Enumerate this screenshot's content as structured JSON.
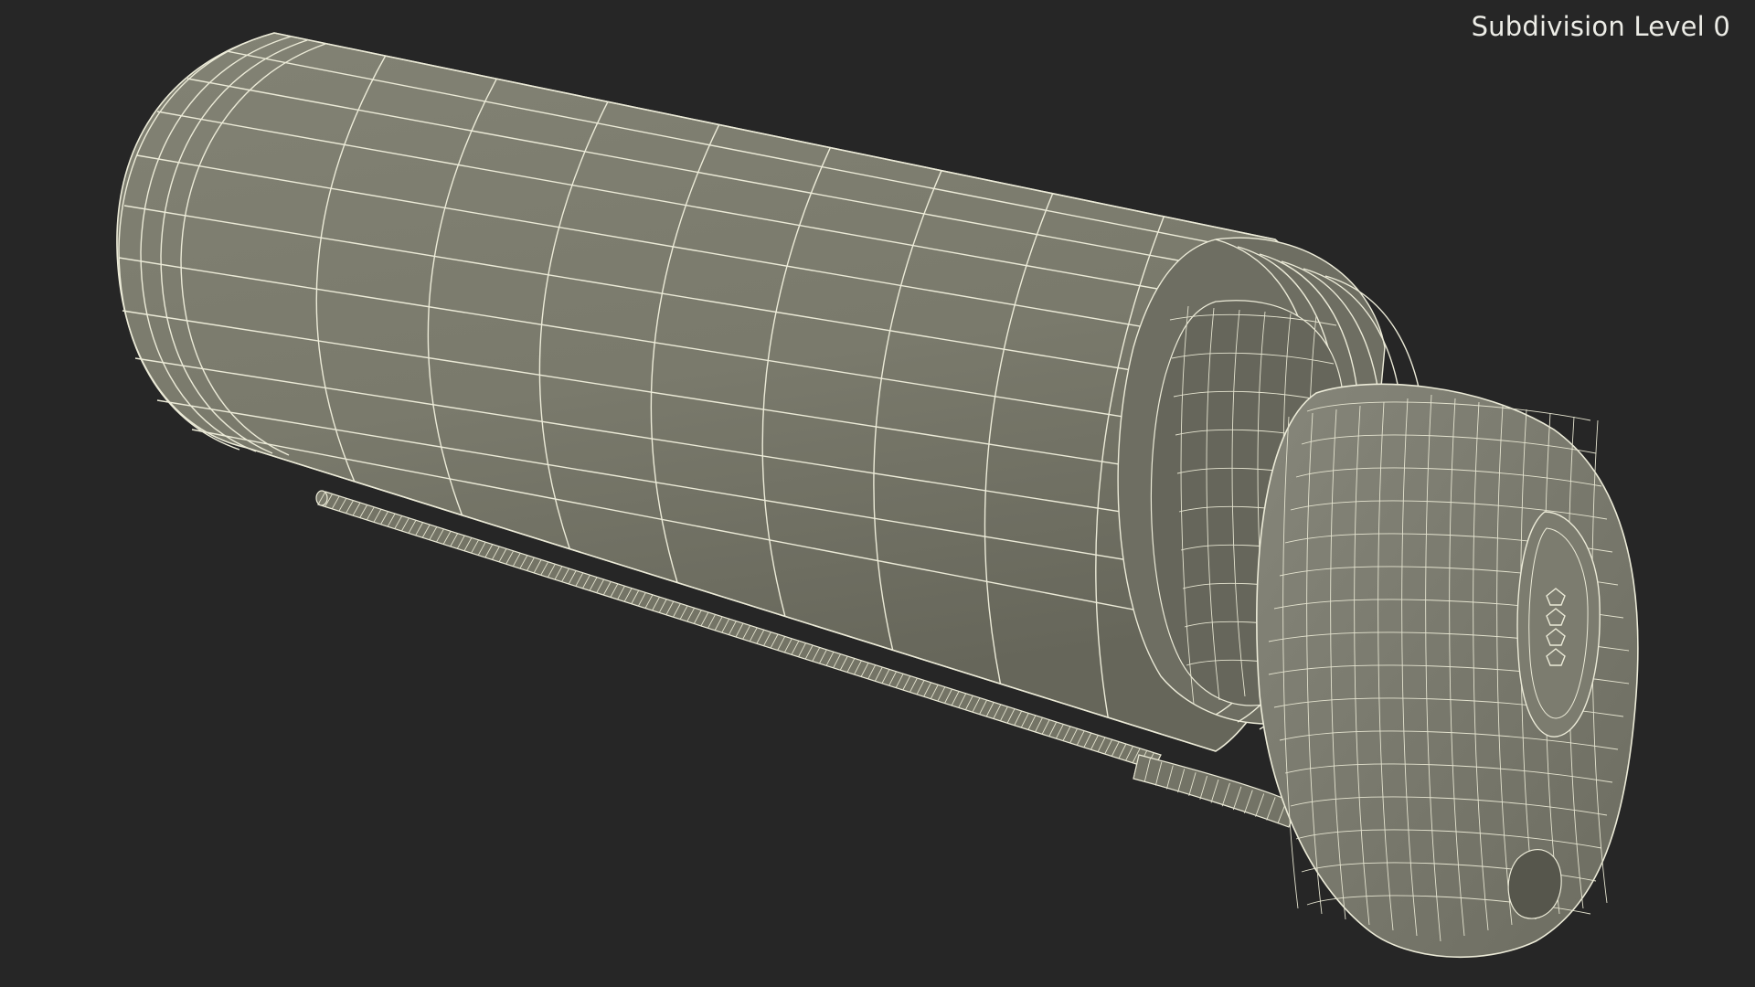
{
  "overlay": {
    "subdivision_label": "Subdivision Level 0"
  },
  "colors": {
    "background": "#262626",
    "mesh_fill": "#7a7a6c",
    "mesh_shadow": "#5f5f53",
    "wire": "#ecebd8",
    "label_text": "#ecece6"
  }
}
